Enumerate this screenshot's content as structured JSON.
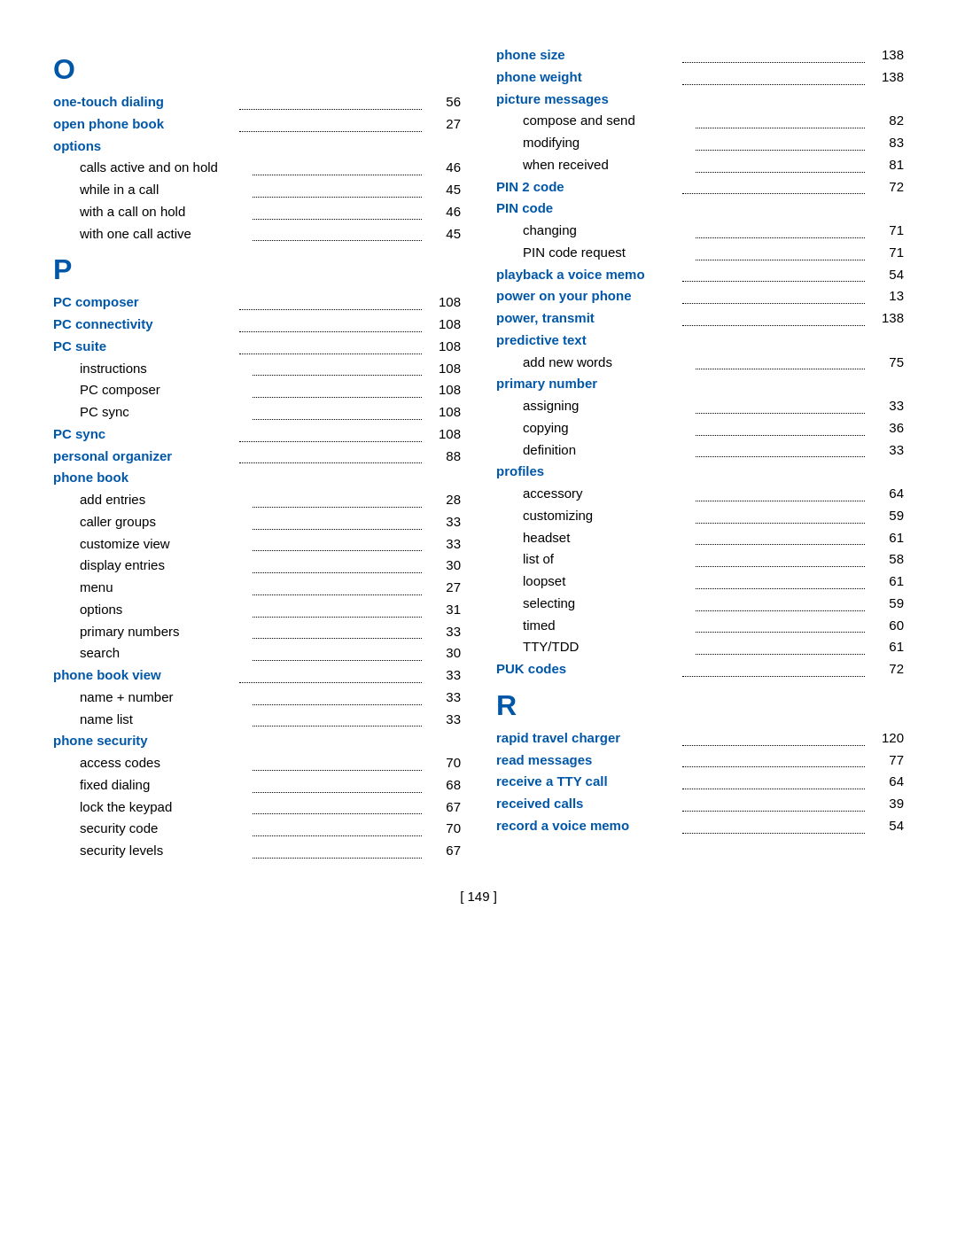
{
  "footer": "[ 149 ]",
  "left_column": {
    "sections": [
      {
        "letter": "O",
        "entries": [
          {
            "label": "one-touch dialing",
            "page": "56",
            "bold": true,
            "indent": 0,
            "dots": true
          },
          {
            "label": "open phone book",
            "page": "27",
            "bold": true,
            "indent": 0,
            "dots": true
          },
          {
            "label": "options",
            "page": "",
            "bold": true,
            "indent": 0,
            "dots": false
          },
          {
            "label": "calls active and on hold",
            "page": "46",
            "bold": false,
            "indent": 1,
            "dots": true,
            "short_dots": true
          },
          {
            "label": "while in a call",
            "page": "45",
            "bold": false,
            "indent": 1,
            "dots": true
          },
          {
            "label": "with a call on hold",
            "page": "46",
            "bold": false,
            "indent": 1,
            "dots": true,
            "short_dots": true
          },
          {
            "label": "with one call active",
            "page": "45",
            "bold": false,
            "indent": 1,
            "dots": true,
            "short_dots": true
          }
        ]
      },
      {
        "letter": "P",
        "entries": [
          {
            "label": "PC composer",
            "page": "108",
            "bold": true,
            "indent": 0,
            "dots": true
          },
          {
            "label": "PC connectivity",
            "page": "108",
            "bold": true,
            "indent": 0,
            "dots": true
          },
          {
            "label": "PC suite",
            "page": "108",
            "bold": true,
            "indent": 0,
            "dots": true
          },
          {
            "label": "instructions",
            "page": "108",
            "bold": false,
            "indent": 1,
            "dots": true
          },
          {
            "label": "PC composer",
            "page": "108",
            "bold": false,
            "indent": 1,
            "dots": true
          },
          {
            "label": "PC sync",
            "page": "108",
            "bold": false,
            "indent": 1,
            "dots": true
          },
          {
            "label": "PC sync",
            "page": "108",
            "bold": true,
            "indent": 0,
            "dots": true
          },
          {
            "label": "personal organizer",
            "page": "88",
            "bold": true,
            "indent": 0,
            "dots": true
          },
          {
            "label": "phone book",
            "page": "",
            "bold": true,
            "indent": 0,
            "dots": false
          },
          {
            "label": "add entries",
            "page": "28",
            "bold": false,
            "indent": 1,
            "dots": true
          },
          {
            "label": "caller groups",
            "page": "33",
            "bold": false,
            "indent": 1,
            "dots": true
          },
          {
            "label": "customize view",
            "page": "33",
            "bold": false,
            "indent": 1,
            "dots": true
          },
          {
            "label": "display entries",
            "page": "30",
            "bold": false,
            "indent": 1,
            "dots": true
          },
          {
            "label": "menu",
            "page": "27",
            "bold": false,
            "indent": 1,
            "dots": true
          },
          {
            "label": "options",
            "page": "31",
            "bold": false,
            "indent": 1,
            "dots": true
          },
          {
            "label": "primary numbers",
            "page": "33",
            "bold": false,
            "indent": 1,
            "dots": true,
            "short_dots": true
          },
          {
            "label": "search",
            "page": "30",
            "bold": false,
            "indent": 1,
            "dots": true
          },
          {
            "label": "phone book view",
            "page": "33",
            "bold": true,
            "indent": 0,
            "dots": true
          },
          {
            "label": "name + number",
            "page": "33",
            "bold": false,
            "indent": 1,
            "dots": true
          },
          {
            "label": "name list",
            "page": "33",
            "bold": false,
            "indent": 1,
            "dots": true
          },
          {
            "label": "phone security",
            "page": "",
            "bold": true,
            "indent": 0,
            "dots": false
          },
          {
            "label": "access codes",
            "page": "70",
            "bold": false,
            "indent": 1,
            "dots": true
          },
          {
            "label": "fixed dialing",
            "page": "68",
            "bold": false,
            "indent": 1,
            "dots": true
          },
          {
            "label": "lock the keypad",
            "page": "67",
            "bold": false,
            "indent": 1,
            "dots": true
          },
          {
            "label": "security code",
            "page": "70",
            "bold": false,
            "indent": 1,
            "dots": true
          },
          {
            "label": "security levels",
            "page": "67",
            "bold": false,
            "indent": 1,
            "dots": true
          }
        ]
      }
    ]
  },
  "right_column": {
    "sections": [
      {
        "letter": "",
        "entries": [
          {
            "label": "phone size",
            "page": "138",
            "bold": true,
            "indent": 0,
            "dots": true
          },
          {
            "label": "phone weight",
            "page": "138",
            "bold": true,
            "indent": 0,
            "dots": true
          },
          {
            "label": "picture messages",
            "page": "",
            "bold": true,
            "indent": 0,
            "dots": false
          },
          {
            "label": "compose and send",
            "page": "82",
            "bold": false,
            "indent": 1,
            "dots": true,
            "short_dots": true
          },
          {
            "label": "modifying",
            "page": "83",
            "bold": false,
            "indent": 1,
            "dots": true
          },
          {
            "label": "when received",
            "page": "81",
            "bold": false,
            "indent": 1,
            "dots": true
          },
          {
            "label": "PIN 2 code",
            "page": "72",
            "bold": true,
            "indent": 0,
            "dots": true
          },
          {
            "label": "PIN code",
            "page": "",
            "bold": true,
            "indent": 0,
            "dots": false
          },
          {
            "label": "changing",
            "page": "71",
            "bold": false,
            "indent": 1,
            "dots": true
          },
          {
            "label": "PIN code request",
            "page": "71",
            "bold": false,
            "indent": 1,
            "dots": true,
            "short_dots": true
          },
          {
            "label": "playback a voice memo",
            "page": "54",
            "bold": true,
            "indent": 0,
            "dots": true,
            "short_dots": true
          },
          {
            "label": "power on your phone",
            "page": "13",
            "bold": true,
            "indent": 0,
            "dots": true,
            "short_dots": true
          },
          {
            "label": "power, transmit",
            "page": "138",
            "bold": true,
            "indent": 0,
            "dots": true
          },
          {
            "label": "predictive text",
            "page": "",
            "bold": true,
            "indent": 0,
            "dots": false
          },
          {
            "label": "add new words",
            "page": "75",
            "bold": false,
            "indent": 1,
            "dots": true
          },
          {
            "label": "primary number",
            "page": "",
            "bold": true,
            "indent": 0,
            "dots": false
          },
          {
            "label": "assigning",
            "page": "33",
            "bold": false,
            "indent": 1,
            "dots": true
          },
          {
            "label": "copying",
            "page": "36",
            "bold": false,
            "indent": 1,
            "dots": true
          },
          {
            "label": "definition",
            "page": "33",
            "bold": false,
            "indent": 1,
            "dots": true
          },
          {
            "label": "profiles",
            "page": "",
            "bold": true,
            "indent": 0,
            "dots": false
          },
          {
            "label": "accessory",
            "page": "64",
            "bold": false,
            "indent": 1,
            "dots": true
          },
          {
            "label": "customizing",
            "page": "59",
            "bold": false,
            "indent": 1,
            "dots": true
          },
          {
            "label": "headset",
            "page": "61",
            "bold": false,
            "indent": 1,
            "dots": true
          },
          {
            "label": "list of",
            "page": "58",
            "bold": false,
            "indent": 1,
            "dots": true
          },
          {
            "label": "loopset",
            "page": "61",
            "bold": false,
            "indent": 1,
            "dots": true
          },
          {
            "label": "selecting",
            "page": "59",
            "bold": false,
            "indent": 1,
            "dots": true
          },
          {
            "label": "timed",
            "page": "60",
            "bold": false,
            "indent": 1,
            "dots": true
          },
          {
            "label": "TTY/TDD",
            "page": "61",
            "bold": false,
            "indent": 1,
            "dots": true
          },
          {
            "label": "PUK codes",
            "page": "72",
            "bold": true,
            "indent": 0,
            "dots": true
          }
        ]
      },
      {
        "letter": "R",
        "entries": [
          {
            "label": "rapid travel charger",
            "page": "120",
            "bold": true,
            "indent": 0,
            "dots": true,
            "short_dots": true
          },
          {
            "label": "read messages",
            "page": "77",
            "bold": true,
            "indent": 0,
            "dots": true
          },
          {
            "label": "receive a TTY call",
            "page": "64",
            "bold": true,
            "indent": 0,
            "dots": true
          },
          {
            "label": "received calls",
            "page": "39",
            "bold": true,
            "indent": 0,
            "dots": true
          },
          {
            "label": "record a voice memo",
            "page": "54",
            "bold": true,
            "indent": 0,
            "dots": true,
            "short_dots": true
          }
        ]
      }
    ]
  }
}
